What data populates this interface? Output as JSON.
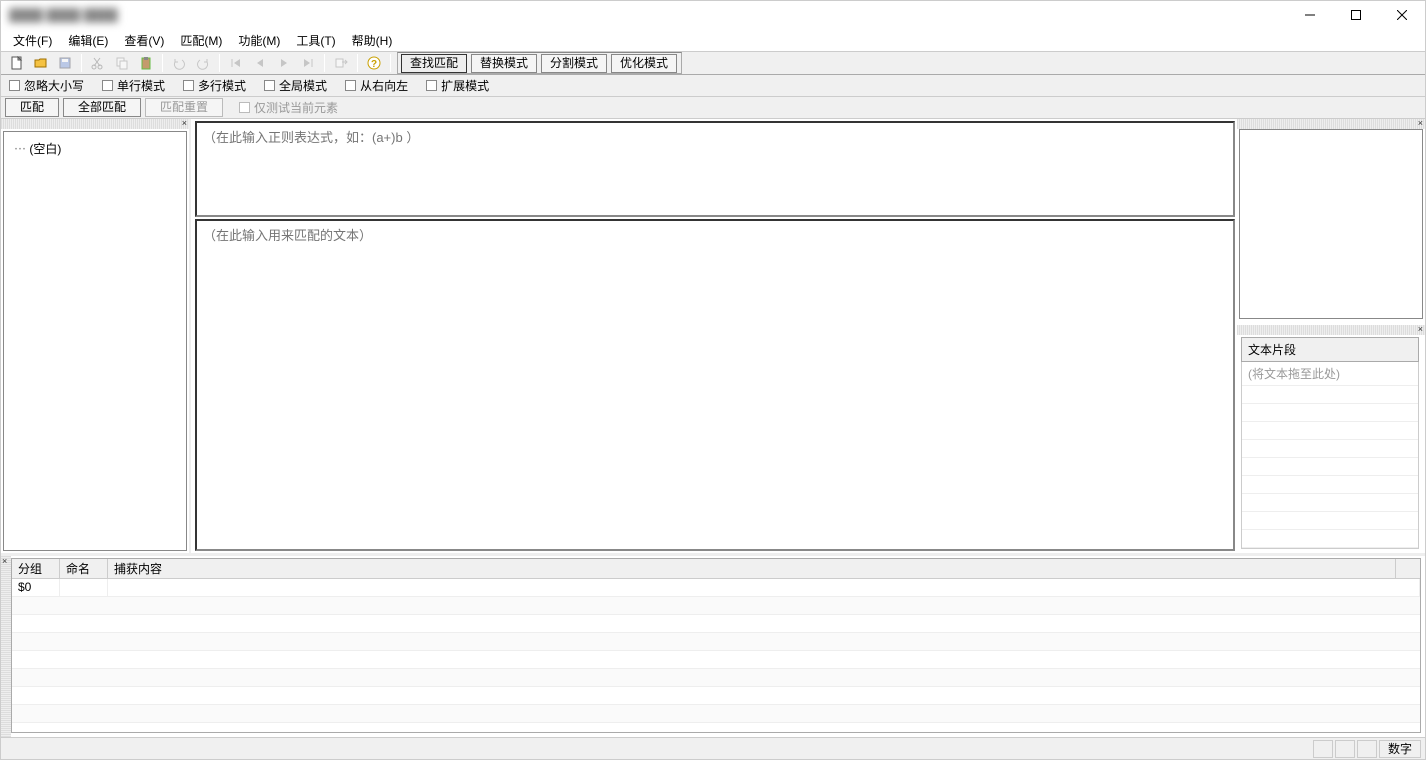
{
  "menu": {
    "file": "文件(F)",
    "edit": "编辑(E)",
    "view": "查看(V)",
    "match": "匹配(M)",
    "func": "功能(M)",
    "tools": "工具(T)",
    "help": "帮助(H)"
  },
  "modes": {
    "find": "查找匹配",
    "replace": "替换模式",
    "split": "分割模式",
    "optimize": "优化模式"
  },
  "opts": {
    "ignorecase": "忽略大小写",
    "singleline": "单行模式",
    "multiline": "多行模式",
    "global": "全局模式",
    "rtl": "从右向左",
    "extended": "扩展模式"
  },
  "actions": {
    "match": "匹配",
    "matchall": "全部匹配",
    "reset": "匹配重置",
    "onlycurrent": "仅测试当前元素"
  },
  "tree": {
    "root": "(空白)"
  },
  "inputs": {
    "regex_placeholder": "（在此输入正则表达式，如：(a+)b ）",
    "text_placeholder": "（在此输入用来匹配的文本）"
  },
  "snippet": {
    "header": "文本片段",
    "placeholder": "(将文本拖至此处)"
  },
  "grid": {
    "cols": {
      "group": "分组",
      "name": "命名",
      "content": "捕获内容"
    },
    "rows": [
      {
        "group": "$0",
        "name": "",
        "content": ""
      }
    ]
  },
  "status": {
    "numlock": "数字"
  }
}
